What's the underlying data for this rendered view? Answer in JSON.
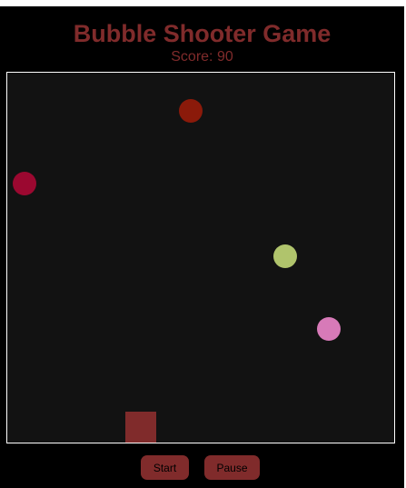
{
  "game": {
    "title": "Bubble Shooter Game",
    "score_text": "Score: 90",
    "accent_color": "#802b2b",
    "board_color": "#121212",
    "border_color": "#ffffff"
  },
  "bubbles": [
    {
      "color": "#8b1a0a"
    },
    {
      "color": "#9b0830"
    },
    {
      "color": "#b0c46c"
    },
    {
      "color": "#d77ab8"
    }
  ],
  "shooter": {
    "color": "#802b2b"
  },
  "controls": {
    "start_label": "Start",
    "pause_label": "Pause"
  }
}
